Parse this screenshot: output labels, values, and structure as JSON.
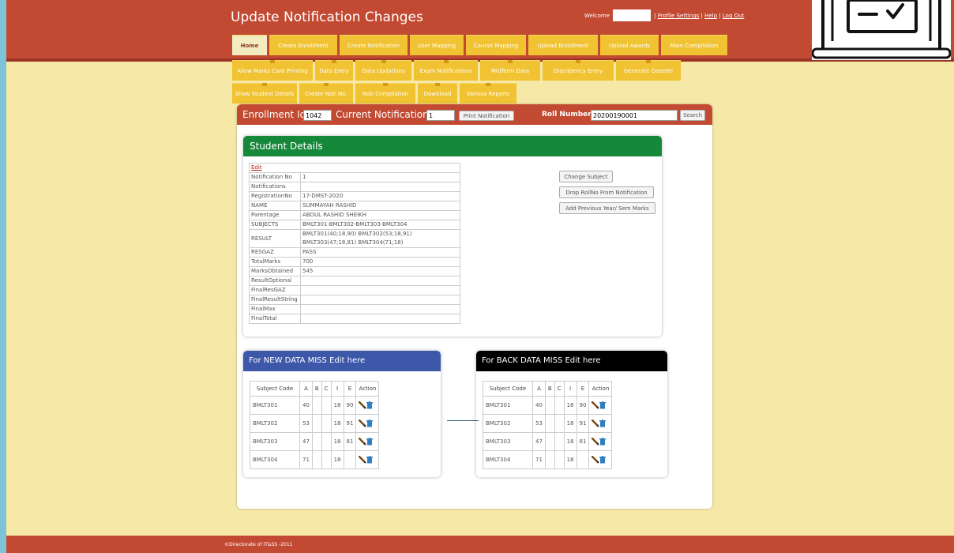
{
  "header": {
    "title": "Update Notification Changes",
    "welcome_label": "Welcome",
    "links": [
      "Profile Settings",
      "Help",
      "Log Out"
    ]
  },
  "tabs_row1": [
    "Home",
    "Create Enrollment",
    "Create Notification",
    "User Mapping",
    "Course Mapping",
    "Upload Enrollment",
    "Upload Awards",
    "Main Compilation"
  ],
  "tabs_row2": [
    "Allow Marks Card Printing",
    "Data Entry",
    "Data Updations",
    "Exam Notifications",
    "MidTerm Data",
    "Discripency Entry",
    "Generate Gazette"
  ],
  "tabs_row3": [
    "Show Student Details",
    "Create Noti No.",
    "Noti Compilation",
    "Download",
    "Various Reports"
  ],
  "toolbar": {
    "enrollment_label": "Enrollment Id::",
    "enrollment_value": "1042",
    "notification_label": "Current Notification No",
    "notification_value": "1",
    "print_button": "Print Notification",
    "roll_label": "Roll Number",
    "roll_value": "20200190001",
    "search_button": "Search"
  },
  "student_details": {
    "title": "Student Details",
    "edit_label": "Edit",
    "rows": [
      {
        "key": "Notification No",
        "value": "1"
      },
      {
        "key": "Notifications",
        "value": ""
      },
      {
        "key": "RegistrationNo",
        "value": "17-DMST-2020"
      },
      {
        "key": "NAME",
        "value": "SUMMAYAH RASHID"
      },
      {
        "key": "Parentage",
        "value": "ABDUL RASHID SHEIKH"
      },
      {
        "key": "SUBJECTS",
        "value": "BMLT301-BMLT302-BMLT303-BMLT304"
      },
      {
        "key": "RESULT",
        "value": "BMLT301(40;18,90) BMLT302(53;18,91) BMLT303(47;18,81) BMLT304(71;18)"
      },
      {
        "key": "RESGAZ",
        "value": "PASS"
      },
      {
        "key": "TotalMarks",
        "value": "700"
      },
      {
        "key": "MarksObtained",
        "value": "545"
      },
      {
        "key": "ResultOptional",
        "value": ""
      },
      {
        "key": "FinalResGAZ",
        "value": ""
      },
      {
        "key": "FinalResultString",
        "value": ""
      },
      {
        "key": "FinalMax",
        "value": ""
      },
      {
        "key": "FinalTotal",
        "value": ""
      }
    ],
    "actions": [
      "Change Subject",
      "Drop RollNo From Notification",
      "Add Previous Year/ Sem Marks"
    ]
  },
  "new_data": {
    "title": "For NEW DATA MISS Edit here",
    "color": "#3d58a8",
    "columns": [
      "Subject Code",
      "A",
      "B",
      "C",
      "I",
      "E",
      "Action"
    ],
    "rows": [
      [
        "BMLT301",
        "40",
        "",
        "",
        "18",
        "90"
      ],
      [
        "BMLT302",
        "53",
        "",
        "",
        "18",
        "91"
      ],
      [
        "BMLT303",
        "47",
        "",
        "",
        "18",
        "81"
      ],
      [
        "BMLT304",
        "71",
        "",
        "",
        "18",
        ""
      ]
    ]
  },
  "back_data": {
    "title": "For BACK DATA MISS Edit here",
    "color": "#000000",
    "columns": [
      "Subject Code",
      "A",
      "B",
      "C",
      "I",
      "E",
      "Action"
    ],
    "rows": [
      [
        "BMLT301",
        "40",
        "",
        "",
        "18",
        "90"
      ],
      [
        "BMLT302",
        "53",
        "",
        "",
        "18",
        "91"
      ],
      [
        "BMLT303",
        "47",
        "",
        "",
        "18",
        "81"
      ],
      [
        "BMLT304",
        "71",
        "",
        "",
        "18",
        ""
      ]
    ]
  },
  "footer": {
    "copyright": "©Directorate of IT&SS -2011"
  },
  "colors": {
    "brand": "#c24a33",
    "tab": "#f1c232",
    "student_header": "#16883a",
    "page_bg": "#f6e8a6"
  },
  "icons": [
    "edit-pencil-icon",
    "delete-trash-icon",
    "laptop-checklist-icon"
  ]
}
